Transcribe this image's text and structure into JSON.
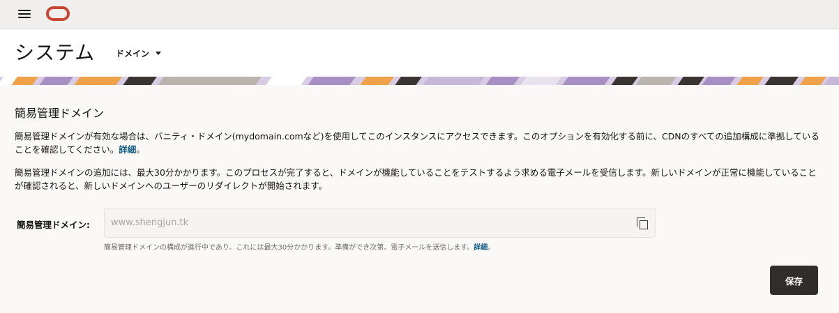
{
  "header": {
    "title": "システム",
    "domain_dropdown": "ドメイン"
  },
  "section": {
    "title": "簡易管理ドメイン",
    "para1_text": "簡易管理ドメインが有効な場合は、バニティ・ドメイン(mydomain.comなど)を使用してこのインスタンスにアクセスできます。このオプションを有効化する前に、CDNのすべての追加構成に準拠していることを確認してください。",
    "para1_link": "詳細",
    "para1_end": "。",
    "para2_text": "簡易管理ドメインの追加には、最大30分かかります。このプロセスが完了すると、ドメインが機能していることをテストするよう求める電子メールを受信します。新しいドメインが正常に機能していることが確認されると、新しいドメインへのユーザーのリダイレクトが開始されます。"
  },
  "field": {
    "label": "簡易管理ドメイン:",
    "value": "www.shengjun.tk",
    "help_text": "簡易管理ドメインの構成が進行中であり、これには最大30分かかります。準備ができ次第、電子メールを送信します。",
    "help_link": "詳細",
    "help_end": "。"
  },
  "actions": {
    "save_label": "保存"
  },
  "icons": {
    "menu": "hamburger-menu-icon",
    "logo": "oracle-logo",
    "dropdown": "caret-down-icon",
    "copy": "copy-icon"
  },
  "colors": {
    "brand_red": "#c74634",
    "link": "#0d5c88",
    "save_button": "#312d2a",
    "banner_purple": "#a88fc3",
    "banner_orange": "#f0a24b",
    "banner_dark": "#3a3532"
  }
}
